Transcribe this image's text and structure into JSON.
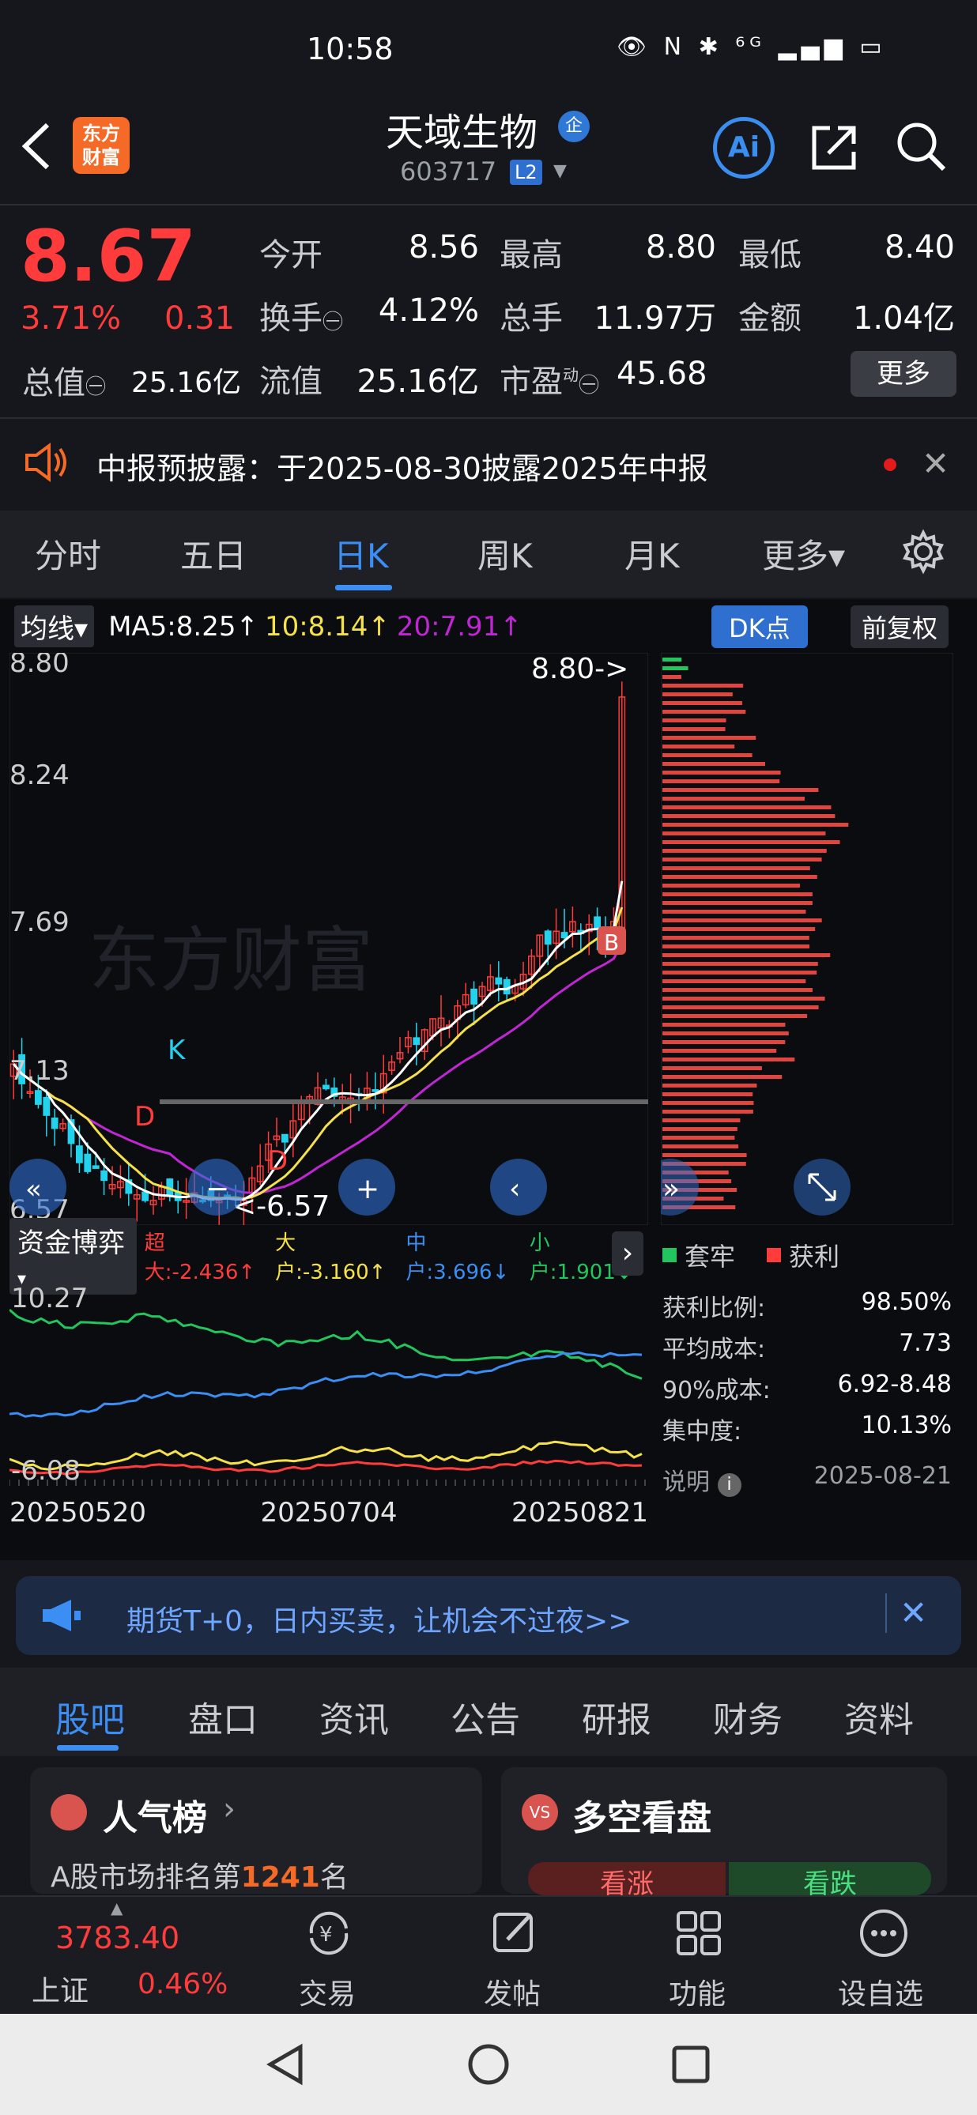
{
  "status_bar": {
    "time": "10:58",
    "icons": "👁 N ✱ ⁶ᴳ ▂▄▆ ▭"
  },
  "header": {
    "name": "天域生物",
    "badge": "企",
    "code": "603717",
    "level": "L2",
    "ai": "Ai",
    "logo_line1": "东方",
    "logo_line2": "财富"
  },
  "quote": {
    "price": "8.67",
    "pct": "3.71%",
    "change": "0.31",
    "open_label": "今开",
    "open": "8.56",
    "high_label": "最高",
    "high": "8.80",
    "low_label": "最低",
    "low": "8.40",
    "turnover_label": "换手",
    "turnover": "4.12%",
    "volume_label": "总手",
    "volume": "11.97万",
    "amount_label": "金额",
    "amount": "1.04亿",
    "mktcap_label": "总值",
    "mktcap": "25.16亿",
    "float_label": "流值",
    "float": "25.16亿",
    "pe_label": "市盈",
    "pe_sup": "动",
    "pe": "45.68",
    "more": "更多"
  },
  "notice": {
    "text": "中报预披露：于2025-08-30披露2025年中报"
  },
  "tabs": [
    "分时",
    "五日",
    "日K",
    "周K",
    "月K",
    "更多▾"
  ],
  "active_tab": "日K",
  "ma": {
    "label": "均线",
    "ma5": "MA5:8.25↑",
    "ma10": "10:8.14↑",
    "ma20": "20:7.91↑",
    "dk": "DK点",
    "fq": "前复权"
  },
  "chart_labels": {
    "y_top": "8.80",
    "y_2": "8.24",
    "y_3": "7.69",
    "y_4": "7.13",
    "y_bottom": "6.57",
    "max_note": "8.80->",
    "min_note": "<-6.57",
    "k_mark": "K",
    "d_mark": "D",
    "b_mark": "B",
    "watermark": "东方财富"
  },
  "fund": {
    "label": "资金博弈",
    "super": "超大:-2.436↑",
    "large": "大户:-3.160↑",
    "mid": "中户:3.696↓",
    "small": "小户:1.901↓",
    "y_top": "10.27",
    "y_bottom": "-6.08"
  },
  "dates": [
    "20250520",
    "20250704",
    "20250821"
  ],
  "cost": {
    "legend_trapped": "套牢",
    "legend_profit": "获利",
    "rows": [
      {
        "label": "获利比例:",
        "value": "98.50%"
      },
      {
        "label": "平均成本:",
        "value": "7.73"
      },
      {
        "label": "90%成本:",
        "value": "6.92-8.48"
      },
      {
        "label": "集中度:",
        "value": "10.13%"
      }
    ],
    "note": "说明",
    "date": "2025-08-21"
  },
  "promo": {
    "text": "期货T+0，日内买卖，让机会不过夜>>"
  },
  "bottom_tabs": [
    "股吧",
    "盘口",
    "资讯",
    "公告",
    "研报",
    "财务",
    "资料"
  ],
  "cards": {
    "left_title": "人气榜",
    "left_sub_pre": "A股市场排名第",
    "left_rank": "1241",
    "left_sub_post": "名",
    "right_title": "多空看盘",
    "up": "看涨",
    "down": "看跌"
  },
  "bottom_nav": {
    "index_value": "3783.40",
    "index_name": "上证",
    "index_pct": "0.46%",
    "trade": "交易",
    "post": "发帖",
    "func": "功能",
    "watch": "设自选"
  },
  "colors": {
    "up": "#ff3b3b",
    "down": "#22d3ee",
    "accent": "#3b8ef3",
    "ma5": "#ffffff",
    "ma10": "#f5e14a",
    "ma20": "#c026d3"
  }
}
